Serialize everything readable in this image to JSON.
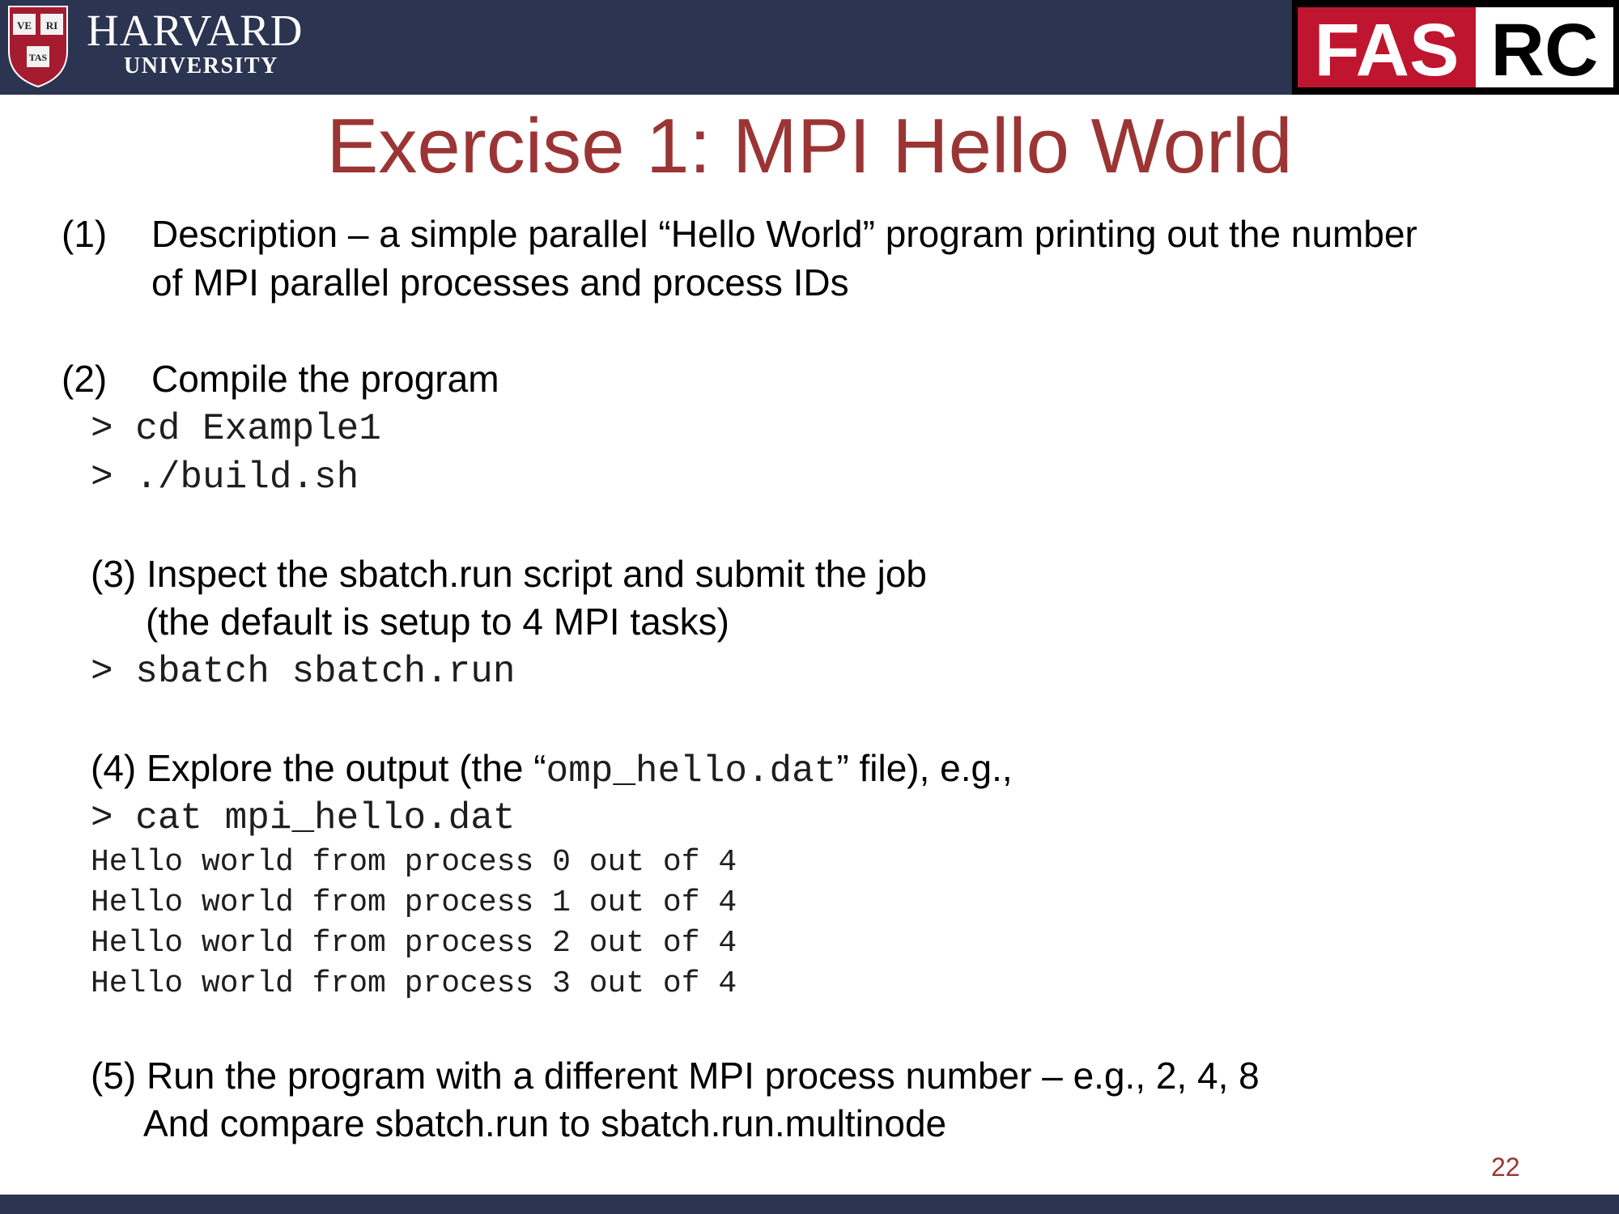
{
  "header": {
    "university_name": "HARVARD",
    "university_sub": "UNIVERSITY",
    "shield_text": [
      "VE",
      "RI",
      "TAS"
    ],
    "logo_left": "FAS",
    "logo_right": "RC",
    "colors": {
      "bar": "#2b3450",
      "logo_red": "#c0152f",
      "title": "#9b3535"
    }
  },
  "title": "Exercise 1: MPI Hello World",
  "steps": {
    "s1": {
      "number": "(1)",
      "line1": "Description – a simple parallel “Hello World” program printing out the number",
      "line2": "of MPI parallel processes and process IDs"
    },
    "s2": {
      "number": "(2)",
      "text": "Compile the program",
      "commands": [
        "> cd Example1",
        "> ./build.sh"
      ]
    },
    "s3": {
      "line1": "(3) Inspect the sbatch.run script and submit the job",
      "line2": "(the default is setup to 4 MPI tasks)",
      "command": "> sbatch sbatch.run"
    },
    "s4": {
      "text_before": "(4) Explore the output (the “",
      "code": "omp_hello.dat",
      "text_after": "” file), e.g.,",
      "command": "> cat mpi_hello.dat",
      "output": [
        "Hello world from process 0 out of 4",
        "Hello world from process 1 out of 4",
        "Hello world from process 2 out of 4",
        "Hello world from process 3 out of 4"
      ]
    },
    "s5": {
      "line1": "(5) Run the program with a different MPI process number – e.g., 2, 4, 8",
      "line2": "And compare sbatch.run  to sbatch.run.multinode"
    }
  },
  "page_number": "22"
}
